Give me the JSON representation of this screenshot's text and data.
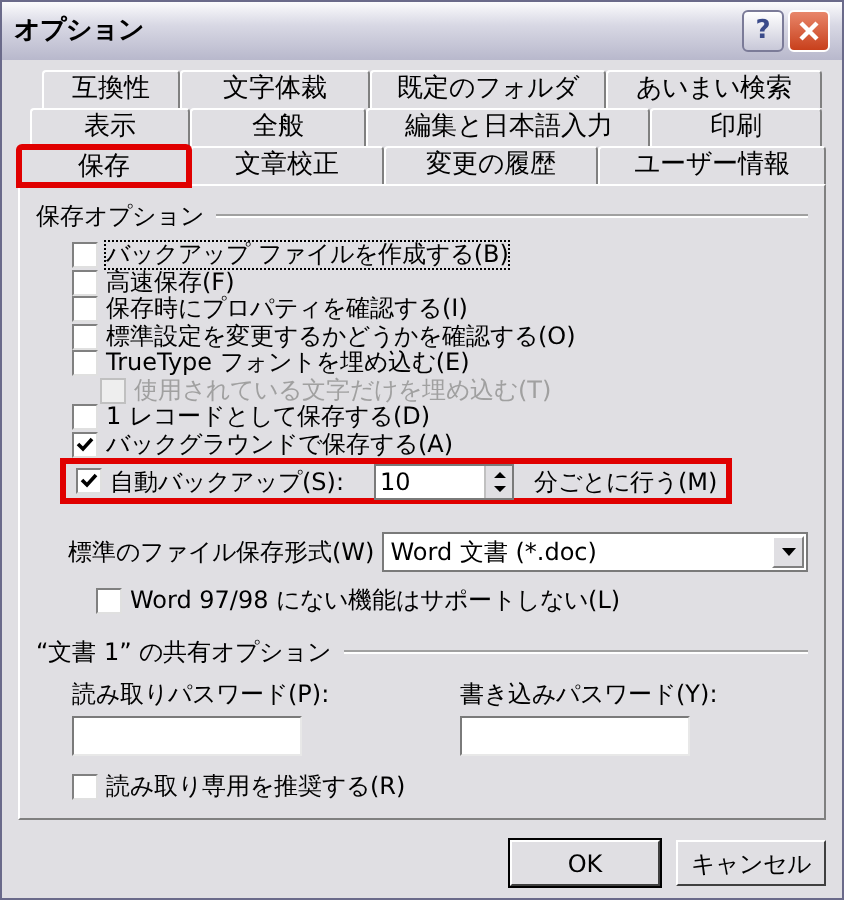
{
  "window": {
    "title": "オプション",
    "help": "?"
  },
  "tab_rows": [
    [
      {
        "label": "互換性",
        "selected": false,
        "highlighted": false
      },
      {
        "label": "文字体裁",
        "selected": false,
        "highlighted": false
      },
      {
        "label": "既定のフォルダ",
        "selected": false,
        "highlighted": false
      },
      {
        "label": "あいまい検索",
        "selected": false,
        "highlighted": false
      }
    ],
    [
      {
        "label": "表示",
        "selected": false,
        "highlighted": false
      },
      {
        "label": "全般",
        "selected": false,
        "highlighted": false
      },
      {
        "label": "編集と日本語入力",
        "selected": false,
        "highlighted": false
      },
      {
        "label": "印刷",
        "selected": false,
        "highlighted": false
      }
    ],
    [
      {
        "label": "保存",
        "selected": true,
        "highlighted": true
      },
      {
        "label": "文章校正",
        "selected": false,
        "highlighted": false
      },
      {
        "label": "変更の履歴",
        "selected": false,
        "highlighted": false
      },
      {
        "label": "ユーザー情報",
        "selected": false,
        "highlighted": false
      }
    ]
  ],
  "save_options": {
    "title": "保存オプション",
    "items": [
      {
        "kind": "checkbox",
        "label": "バックアップ ファイルを作成する(B)",
        "checked": false,
        "focused": true
      },
      {
        "kind": "checkbox",
        "label": "高速保存(F)",
        "checked": false
      },
      {
        "kind": "checkbox",
        "label": "保存時にプロパティを確認する(I)",
        "checked": false
      },
      {
        "kind": "checkbox",
        "label": "標準設定を変更するかどうかを確認する(O)",
        "checked": false
      },
      {
        "kind": "checkbox",
        "label": "TrueType フォントを埋め込む(E)",
        "checked": false,
        "children": [
          {
            "kind": "checkbox",
            "label": "使用されている文字だけを埋め込む(T)",
            "checked": false,
            "disabled": true
          }
        ]
      },
      {
        "kind": "checkbox",
        "label": "1 レコードとして保存する(D)",
        "checked": false
      },
      {
        "kind": "checkbox",
        "label": "バックグラウンドで保存する(A)",
        "checked": true
      },
      {
        "kind": "spin",
        "label": "自動バックアップ(S):",
        "checked": true,
        "value": "10",
        "suffix": "分ごとに行う(M)",
        "highlighted": true
      }
    ]
  },
  "format": {
    "label": "標準のファイル保存形式(W)",
    "value": "Word 文書 (*.doc)"
  },
  "compat": {
    "label": "Word 97/98 にない機能はサポートしない(L)",
    "checked": false
  },
  "sharing": {
    "title": "“文書 1” の共有オプション",
    "read_password": {
      "label": "読み取りパスワード(P):"
    },
    "write_password": {
      "label": "書き込みパスワード(Y):"
    },
    "read_only": {
      "label": "読み取り専用を推奨する(R)",
      "checked": false
    }
  },
  "buttons": [
    {
      "label": "OK"
    },
    {
      "label": "キャンセル"
    }
  ]
}
